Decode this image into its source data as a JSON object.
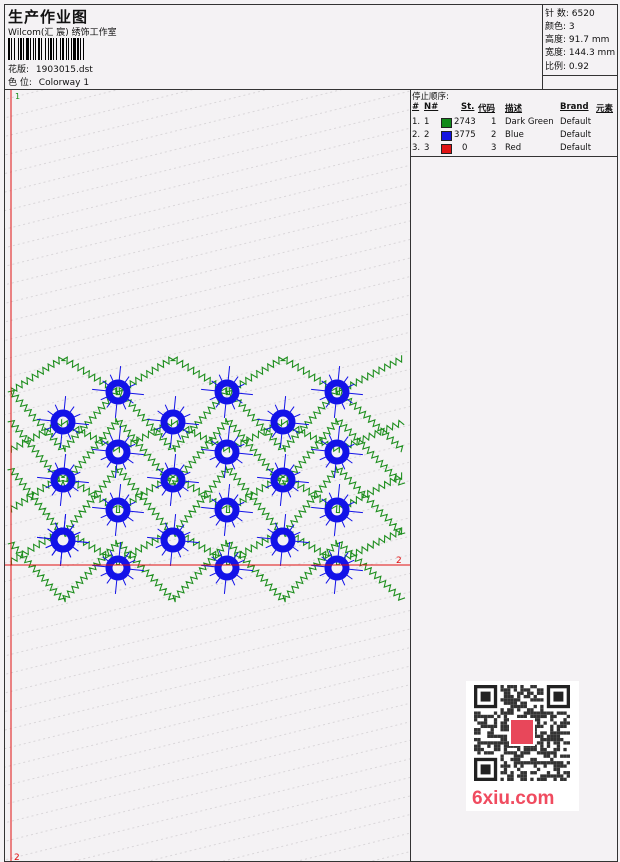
{
  "header": {
    "title": "生产作业图",
    "company": "Wilcom(汇 宸) 绣饰工作室",
    "design_label": "花版:",
    "design_file": "1903015.dst",
    "colorway_label": "色 位:",
    "colorway": "Colorway 1"
  },
  "stats": [
    {
      "label": "针 数:",
      "value": "6520"
    },
    {
      "label": "颜色:",
      "value": "3"
    },
    {
      "label": "高度:",
      "value": "91.7 mm"
    },
    {
      "label": "宽度:",
      "value": "144.3 mm"
    },
    {
      "label": "比例:",
      "value": "0.92"
    }
  ],
  "stop_sequence": {
    "title": "停止顺序:",
    "columns": [
      "#",
      "N#",
      "St.",
      "代码",
      "描述",
      "Brand",
      "元素"
    ],
    "rows": [
      {
        "index": "1.",
        "n": "1",
        "color": "#118a1a",
        "stitches": "2743",
        "code": "1",
        "description": "Dark Green",
        "brand": "Default"
      },
      {
        "index": "2.",
        "n": "2",
        "color": "#1414e0",
        "stitches": "3775",
        "code": "2",
        "description": "Blue",
        "brand": "Default"
      },
      {
        "index": "3.",
        "n": "3",
        "color": "#e01414",
        "stitches": "0",
        "code": "3",
        "description": "Red",
        "brand": "Default"
      }
    ]
  },
  "markers": {
    "start_top": "1",
    "end_right": "2",
    "end_bottom": "2"
  },
  "watermark": "6xiu.com",
  "colors": {
    "green": "#1f8f1f",
    "blue": "#1212e8",
    "red": "#e01010"
  }
}
